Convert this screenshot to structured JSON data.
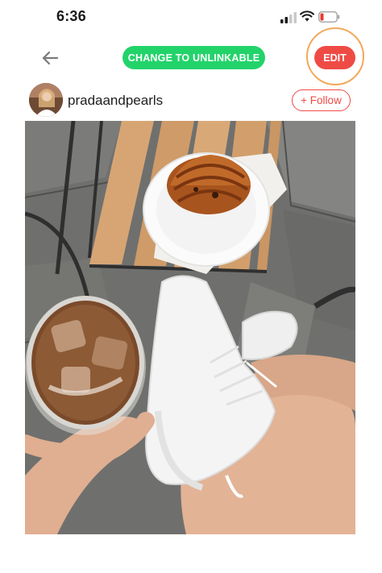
{
  "status_bar": {
    "time": "6:36"
  },
  "header": {
    "toggle_button_label": "CHANGE TO UNLINKABLE",
    "edit_button_label": "EDIT"
  },
  "profile": {
    "username": "pradaandpearls",
    "follow_label": "+ Follow"
  },
  "colors": {
    "green_accent": "#22d36a",
    "red_accent": "#ef4b45",
    "highlight_ring": "#f4a85a"
  },
  "icons": {
    "back": "arrow-left-icon",
    "signal": "cellular-signal-icon",
    "wifi": "wifi-icon",
    "battery": "battery-low-icon"
  }
}
